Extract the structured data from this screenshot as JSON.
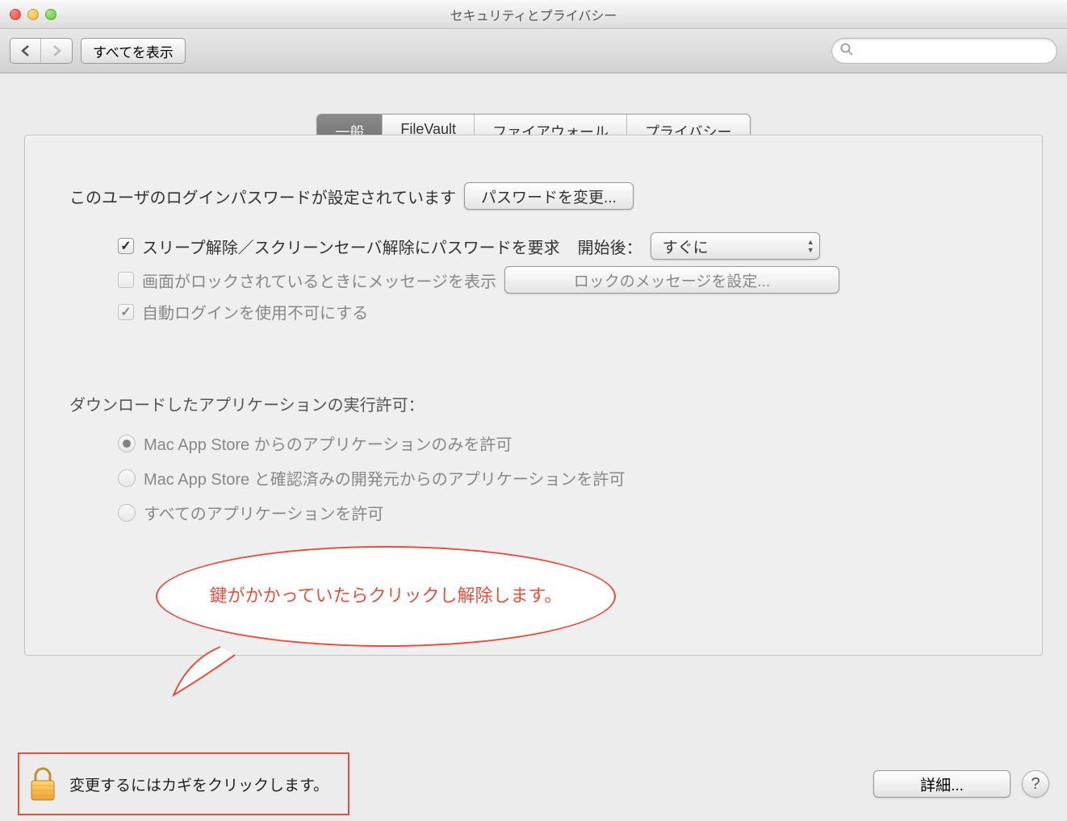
{
  "window": {
    "title": "セキュリティとプライバシー"
  },
  "toolbar": {
    "show_all": "すべてを表示",
    "search_placeholder": ""
  },
  "tabs": {
    "general": "一般",
    "filevault": "FileVault",
    "firewall": "ファイアウォール",
    "privacy": "プライバシー"
  },
  "general": {
    "password_set_label": "このユーザのログインパスワードが設定されています",
    "change_password_btn": "パスワードを変更...",
    "require_password_label": "スリープ解除／スクリーンセーバ解除にパスワードを要求",
    "after_label": "開始後：",
    "after_value": "すぐに",
    "show_lock_message_label": "画面がロックされているときにメッセージを表示",
    "set_lock_message_btn": "ロックのメッセージを設定...",
    "disable_auto_login_label": "自動ログインを使用不可にする",
    "download_section_label": "ダウンロードしたアプリケーションの実行許可：",
    "radio_mas_only": "Mac App Store からのアプリケーションのみを許可",
    "radio_mas_identified": "Mac App Store と確認済みの開発元からのアプリケーションを許可",
    "radio_anywhere": "すべてのアプリケーションを許可"
  },
  "callout": {
    "text": "鍵がかかっていたらクリックし解除します。"
  },
  "footer": {
    "lock_text": "変更するにはカギをクリックします。",
    "details_btn": "詳細...",
    "help": "?"
  }
}
